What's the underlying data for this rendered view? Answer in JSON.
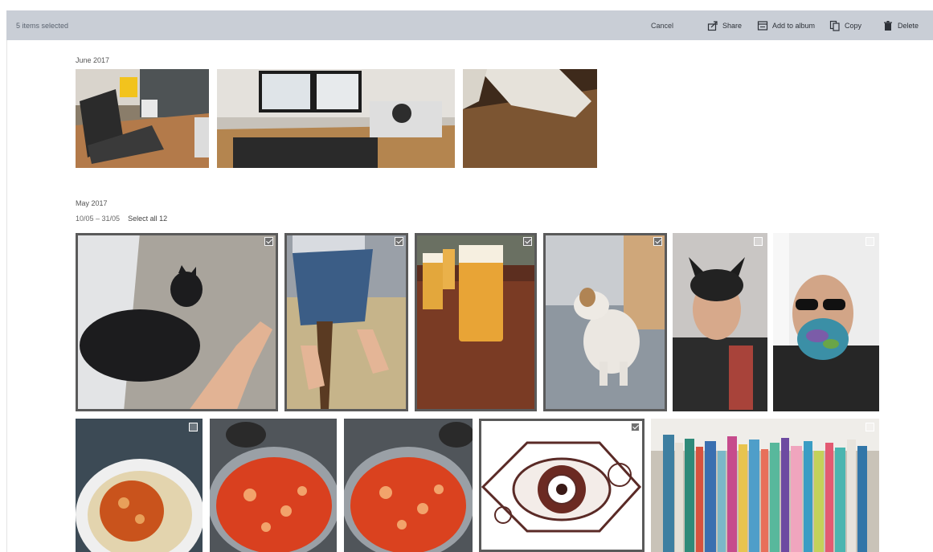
{
  "toolbar": {
    "selected_label": "5 items selected",
    "cancel_label": "Cancel",
    "share_label": "Share",
    "add_to_album_label": "Add to album",
    "copy_label": "Copy",
    "delete_label": "Delete",
    "icons": [
      "share-icon",
      "album-icon",
      "copy-icon",
      "trash-icon",
      "more-icon"
    ]
  },
  "groups": [
    {
      "title": "June 2017",
      "photos": [
        "laptop-desk",
        "monitors-desk",
        "cat-on-sofa"
      ]
    },
    {
      "title": "May 2017",
      "range": "10/05 – 31/05",
      "select_all": "Select all 12",
      "photos": [
        "black-cat",
        "feet-on-step",
        "beer-glasses",
        "white-dog",
        "cat-mask-selfie",
        "sunglasses-selfie",
        "pasta-bowl",
        "tomato-stew-pot",
        "tomato-stew-pot-2",
        "eye-illustration",
        "bookshelf"
      ]
    }
  ],
  "colors": {
    "toolbar_bg": "#c9ced6",
    "selection_outline": "#5a5a5a"
  }
}
